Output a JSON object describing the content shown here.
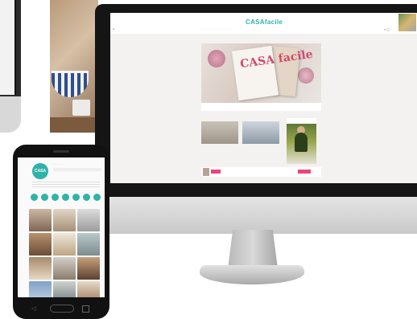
{
  "website": {
    "logo": "CASAfacile",
    "cover_text": "CASA facile"
  }
}
